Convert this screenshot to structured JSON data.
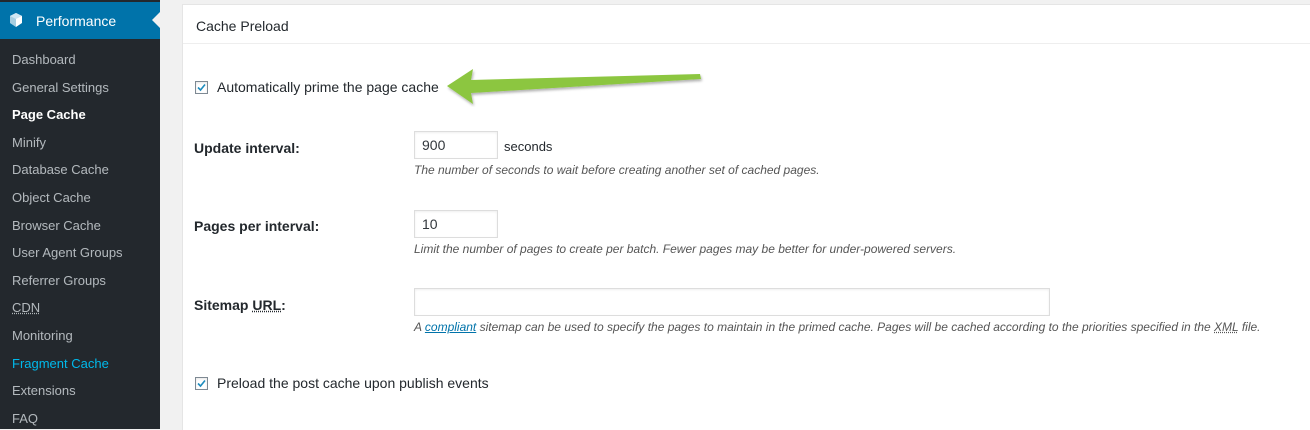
{
  "sidebar": {
    "menu_title": "Performance",
    "icon": "gem-icon",
    "items": [
      {
        "label": "Dashboard"
      },
      {
        "label": "General Settings"
      },
      {
        "label": "Page Cache",
        "current": true
      },
      {
        "label": "Minify"
      },
      {
        "label": "Database Cache"
      },
      {
        "label": "Object Cache"
      },
      {
        "label": "Browser Cache"
      },
      {
        "label": "User Agent Groups"
      },
      {
        "label": "Referrer Groups"
      },
      {
        "label": "CDN"
      },
      {
        "label": "Monitoring"
      },
      {
        "label": "Fragment Cache",
        "highlight": true
      },
      {
        "label": "Extensions"
      },
      {
        "label": "FAQ"
      }
    ]
  },
  "panel": {
    "title": "Cache Preload",
    "auto_prime": {
      "label": "Automatically prime the page cache",
      "checked": true
    },
    "update_interval": {
      "label": "Update interval:",
      "value": "900",
      "unit": "seconds",
      "description": "The number of seconds to wait before creating another set of cached pages."
    },
    "pages_per_interval": {
      "label": "Pages per interval:",
      "value": "10",
      "description": "Limit the number of pages to create per batch. Fewer pages may be better for under-powered servers."
    },
    "sitemap_url": {
      "label_prefix": "Sitemap ",
      "label_abbr": "URL",
      "label_suffix": ":",
      "value": "",
      "desc_a": "A ",
      "desc_link": "compliant",
      "desc_b": " sitemap can be used to specify the pages to maintain in the primed cache. Pages will be cached according to the priorities specified in the ",
      "desc_abbr": "XML",
      "desc_c": " file."
    },
    "preload_post": {
      "label": "Preload the post cache upon publish events",
      "checked": true
    }
  },
  "colors": {
    "sidebar_bg": "#23282d",
    "active_menu": "#0073aa",
    "highlight_item": "#00b9eb",
    "arrow": "#8cc63f"
  }
}
